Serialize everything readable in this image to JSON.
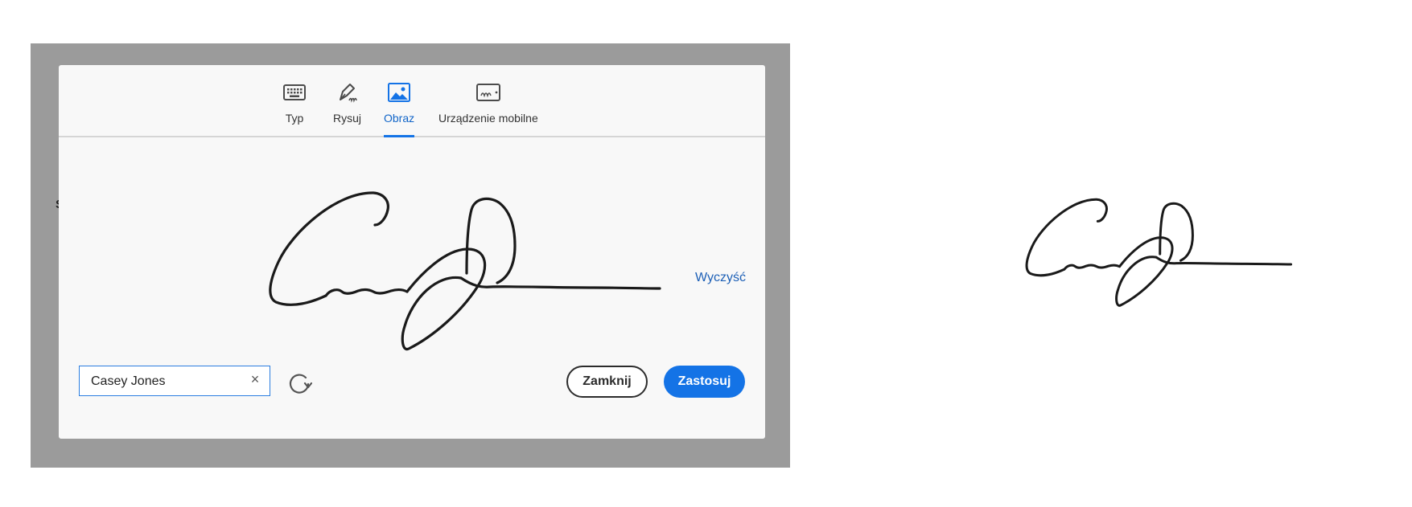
{
  "background": {
    "fragment_text": "S"
  },
  "tabs": [
    {
      "label": "Typ",
      "icon": "keyboard-icon"
    },
    {
      "label": "Rysuj",
      "icon": "pen-icon"
    },
    {
      "label": "Obraz",
      "icon": "image-icon",
      "active": true
    },
    {
      "label": "Urządzenie mobilne",
      "icon": "mobile-device-icon"
    }
  ],
  "signature_area": {
    "clear_label": "Wyczyść"
  },
  "name_input": {
    "value": "Casey Jones"
  },
  "buttons": {
    "close_label": "Zamknij",
    "apply_label": "Zastosuj"
  },
  "colors": {
    "accent": "#1473e6",
    "overlay": "#9b9b9b",
    "dialog": "#f8f8f8"
  }
}
